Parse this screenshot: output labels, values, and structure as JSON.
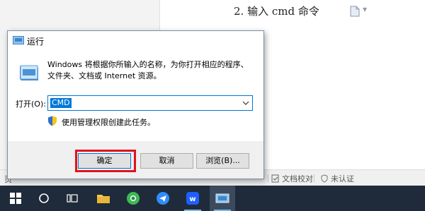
{
  "document": {
    "step_text": "2. 输入 cmd 命令"
  },
  "statusbar": {
    "left_text": "页",
    "proofread_label": "文档校对",
    "unauthenticated_label": "未认证"
  },
  "run_dialog": {
    "title": "运行",
    "description": "Windows 将根据你所输入的名称，为你打开相应的程序、文件夹、文档或 Internet 资源。",
    "open_label": "打开(O):",
    "input_value": "CMD",
    "admin_note": "使用管理权限创建此任务。",
    "ok_label": "确定",
    "cancel_label": "取消",
    "browse_label": "浏览(B)..."
  },
  "taskbar": {
    "items": [
      "windows-start",
      "search",
      "task-view",
      "file-explorer",
      "browser",
      "feishu",
      "wps",
      "run"
    ]
  },
  "colors": {
    "accent": "#0078d7",
    "highlight": "#e3121b",
    "taskbar": "#1f2b3a"
  }
}
